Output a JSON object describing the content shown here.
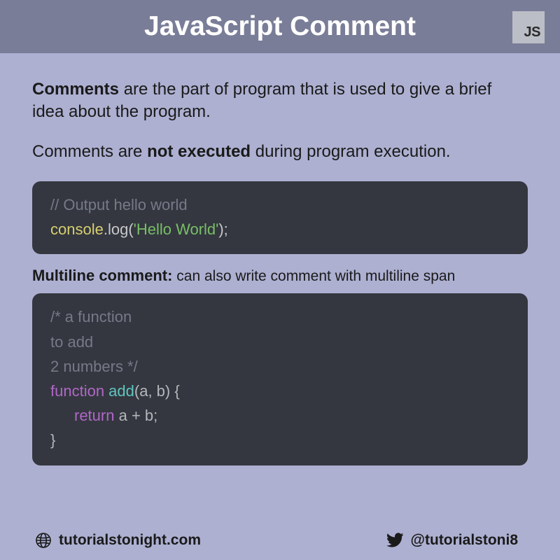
{
  "header": {
    "title": "JavaScript Comment",
    "badge": "JS"
  },
  "intro": {
    "lead": "Comments",
    "rest": " are the part of program that is used to give a brief idea about the program."
  },
  "intro2": {
    "pre": "Comments are ",
    "bold": "not executed",
    "post": " during program execution."
  },
  "code1": {
    "c1": "// Output hello world",
    "l2_a": "console",
    "l2_b": ".log(",
    "l2_c": "'Hello World'",
    "l2_d": ");"
  },
  "subhead": {
    "bold": "Multiline comment:",
    "rest": " can also write comment with multiline span"
  },
  "code2": {
    "c1": "/* a function",
    "c2": "to add",
    "c3": "2 numbers */",
    "l4_a": "function ",
    "l4_b": "add",
    "l4_c": "(a, b) {",
    "l5_a": "return",
    "l5_b": " a + b;",
    "l6": "}"
  },
  "footer": {
    "site": "tutorialstonight.com",
    "handle": "@tutorialstoni8"
  }
}
